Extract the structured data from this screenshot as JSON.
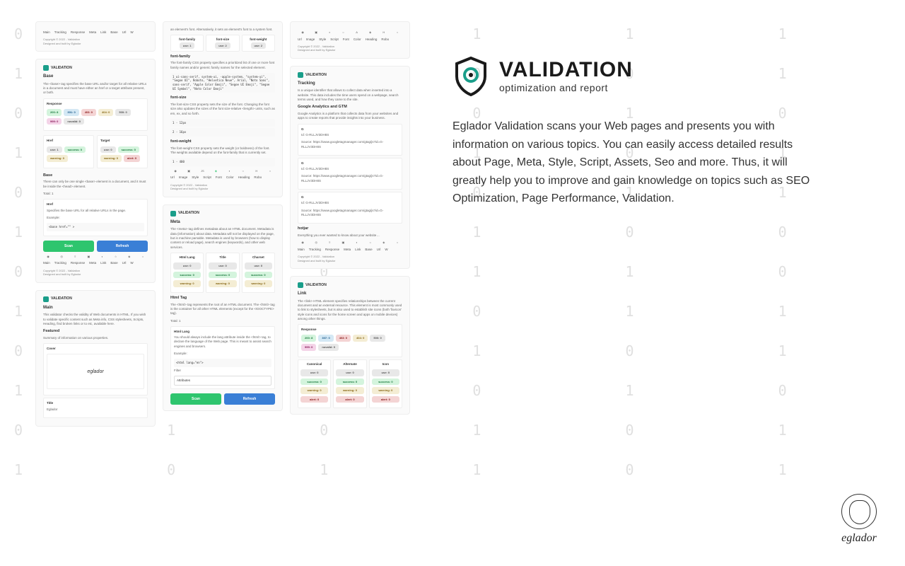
{
  "bg": "0  1  0  1  1  1  0  1  0  1  1\n1  0  1  0  0  1  1  0  1  0  0\n0  1  1  0  1  0  0  1  1  1  0\n1  0  0  1  0  1  1  0  0  1  1\n0  1  1  0  1  1  0  1  0  0  1\n1  0  1  1  0  0  1  1  1  0  0\n0  1  0  1  1  0  0  1  0  1  1\n1  1  0  0  1  1  0  0  1  1  0\n0  0  1  1  0  1  1  0  1  0  1\n1  0  1  0  1  0  1  1  0  1  0\n0  1  0  1  0  1  0  1  1  0  1\n1  0  1  1  0  1  0  0  1  1  0",
  "logo": {
    "title": "VALIDATION",
    "subtitle": "optimization and report"
  },
  "description": "Eglador Validation scans your Web pages and presents you with information on various topics. You can easily access detailed results about Page, Meta, Style, Script, Assets, Seo and more. Thus, it will greatly help you to improve and gain knowledge on topics such as SEO Optimization, Page Performance, Validation.",
  "brand": "eglador",
  "nav": [
    "Main",
    "Tracking",
    "Response",
    "Meta",
    "Link",
    "Base",
    "Url",
    "W"
  ],
  "nav2": [
    "Url",
    "Image",
    "Style",
    "Script",
    "Font",
    "Color",
    "Heading",
    "Robo"
  ],
  "footer": {
    "copy": "Copyright © 2022 - Validation",
    "by": "Designed and built by Eglador"
  },
  "btn": {
    "scan": "Scan",
    "refresh": "Refresh"
  },
  "col1": {
    "base": {
      "title": "Base",
      "desc": "The <base> tag specifies the base URL and/or target for all relative URLs in a document and must have either an href or a target attribute present, or both.",
      "response": "Response",
      "base2": "Base",
      "base2desc": "There can only be one single <base> element in a document, and it must be inside the <head> element.",
      "total": "Total: 1",
      "href": "Href",
      "hrefdesc": "Specifies the base URL for all relative URLs in the page.",
      "example": "Example:",
      "code": "<base href=\"\" >",
      "hrefh": "Href",
      "targeth": "Target"
    },
    "main": {
      "title": "Main",
      "desc": "This validator checks the validity of Web documents in HTML. If you wish to validate specific content such as Meta info, CSS stylesheets, Scripts, Heading, find broken links or to etc, available here.",
      "featured": "Featured",
      "featdesc": "Summary of information on various properties.",
      "cover": "Cover",
      "titlelab": "Title",
      "titleval": "Eglador"
    }
  },
  "col2": {
    "font": {
      "desc": "an element's font. Alternatively, it sets an element's font to a system font.",
      "ff": "font-family",
      "fs": "font-size",
      "fw": "font-weight",
      "use1": "use: 1",
      "use2": "use: 2",
      "ffdesc": "The font-family CSS property specifies a prioritized list of one or more font family names and/or generic family names for the selected element.",
      "ffcode": "1 ui-sans-serif, system-ui, -apple-system, \"system-ui\", \"Segoe UI\", Roboto, \"Helvetica Neue\", Arial, \"Noto Sans\", sans-serif, \"Apple Color Emoji\", \"Segoe UI Emoji\", \"Segoe UI Symbol\", \"Noto Color Emoji\"",
      "fsdesc": "The font-size CSS property sets the size of the font. Changing the font size also updates the sizes of the font size-relative <length> units, such as em, ex, and so forth.",
      "fs1": "1 - 12px",
      "fs2": "2 - 16px",
      "fwdesc": "The font-weight CSS property sets the weight (or boldness) of the font. The weights available depend on the font-family that is currently set.",
      "fw1": "1 - 400"
    },
    "meta": {
      "title": "Meta",
      "desc": "The <meta> tag defines metadata about an HTML document. Metadata is data (information) about data. Metadata will not be displayed on the page, but is machine parsable. Metadata is used by browsers (how to display content or reload page), search engines (keywords), and other web services.",
      "hl": "Html Lang",
      "tt": "Title",
      "ch": "Charset",
      "htmltag": "Html Tag",
      "htdesc": "The <html> tag represents the root of an HTML document. The <html> tag is the container for all other HTML elements (except for the <!DOCTYPE> tag).",
      "total": "Total: 1",
      "hldesc": "You should always include the lang attribute inside the <html> tag, to declare the language of the Web page. This is meant to assist search engines and browsers.",
      "example": "Example:",
      "code": "<html lang=\"en\">",
      "filter": "Filter",
      "attr": "Attributes"
    }
  },
  "col3": {
    "tracking": {
      "title": "Tracking",
      "desc": "Is a unique identifier that allows to collect data when inserted into a website. This data includes the time users spend on a webpage, search terms used, and how they came to the site.",
      "ga": "Google Analytics and GTM",
      "gadesc": "Google Analytics is a platform that collects data from your websites and apps to create reports that provide insights into your business.",
      "g": "G",
      "id": "Id: G-RLLJV3DH8S",
      "source": "Source: https://www.googletagmanager.com/gtag/js?id=G-RLLJV3DH8S",
      "hotjar": "hotjar",
      "hjdesc": "Everything you ever wanted to know about your website…"
    },
    "link": {
      "title": "Link",
      "desc": "The <link> HTML element specifies relationships between the current document and an external resource. This element is most commonly used to link to stylesheets, but is also used to establish site icons (both 'favicon' style icons and icons for the home screen and apps on mobile devices) among other things.",
      "response": "Response",
      "can": "Canonical",
      "alt": "Alternate",
      "ico": "Icon"
    }
  },
  "chips": {
    "r200": "200: 8",
    "r301": "301: 0",
    "r403": "403: 0",
    "r404": "404: 0",
    "r500": "500: 0",
    "r999": "999: 0",
    "novalid": "novalid: 0",
    "use0": "use: 0",
    "use1": "use: 1",
    "success0": "success: 0",
    "warning0": "warning: 0",
    "alert0": "alert: 0",
    "r307": "307: 0"
  }
}
